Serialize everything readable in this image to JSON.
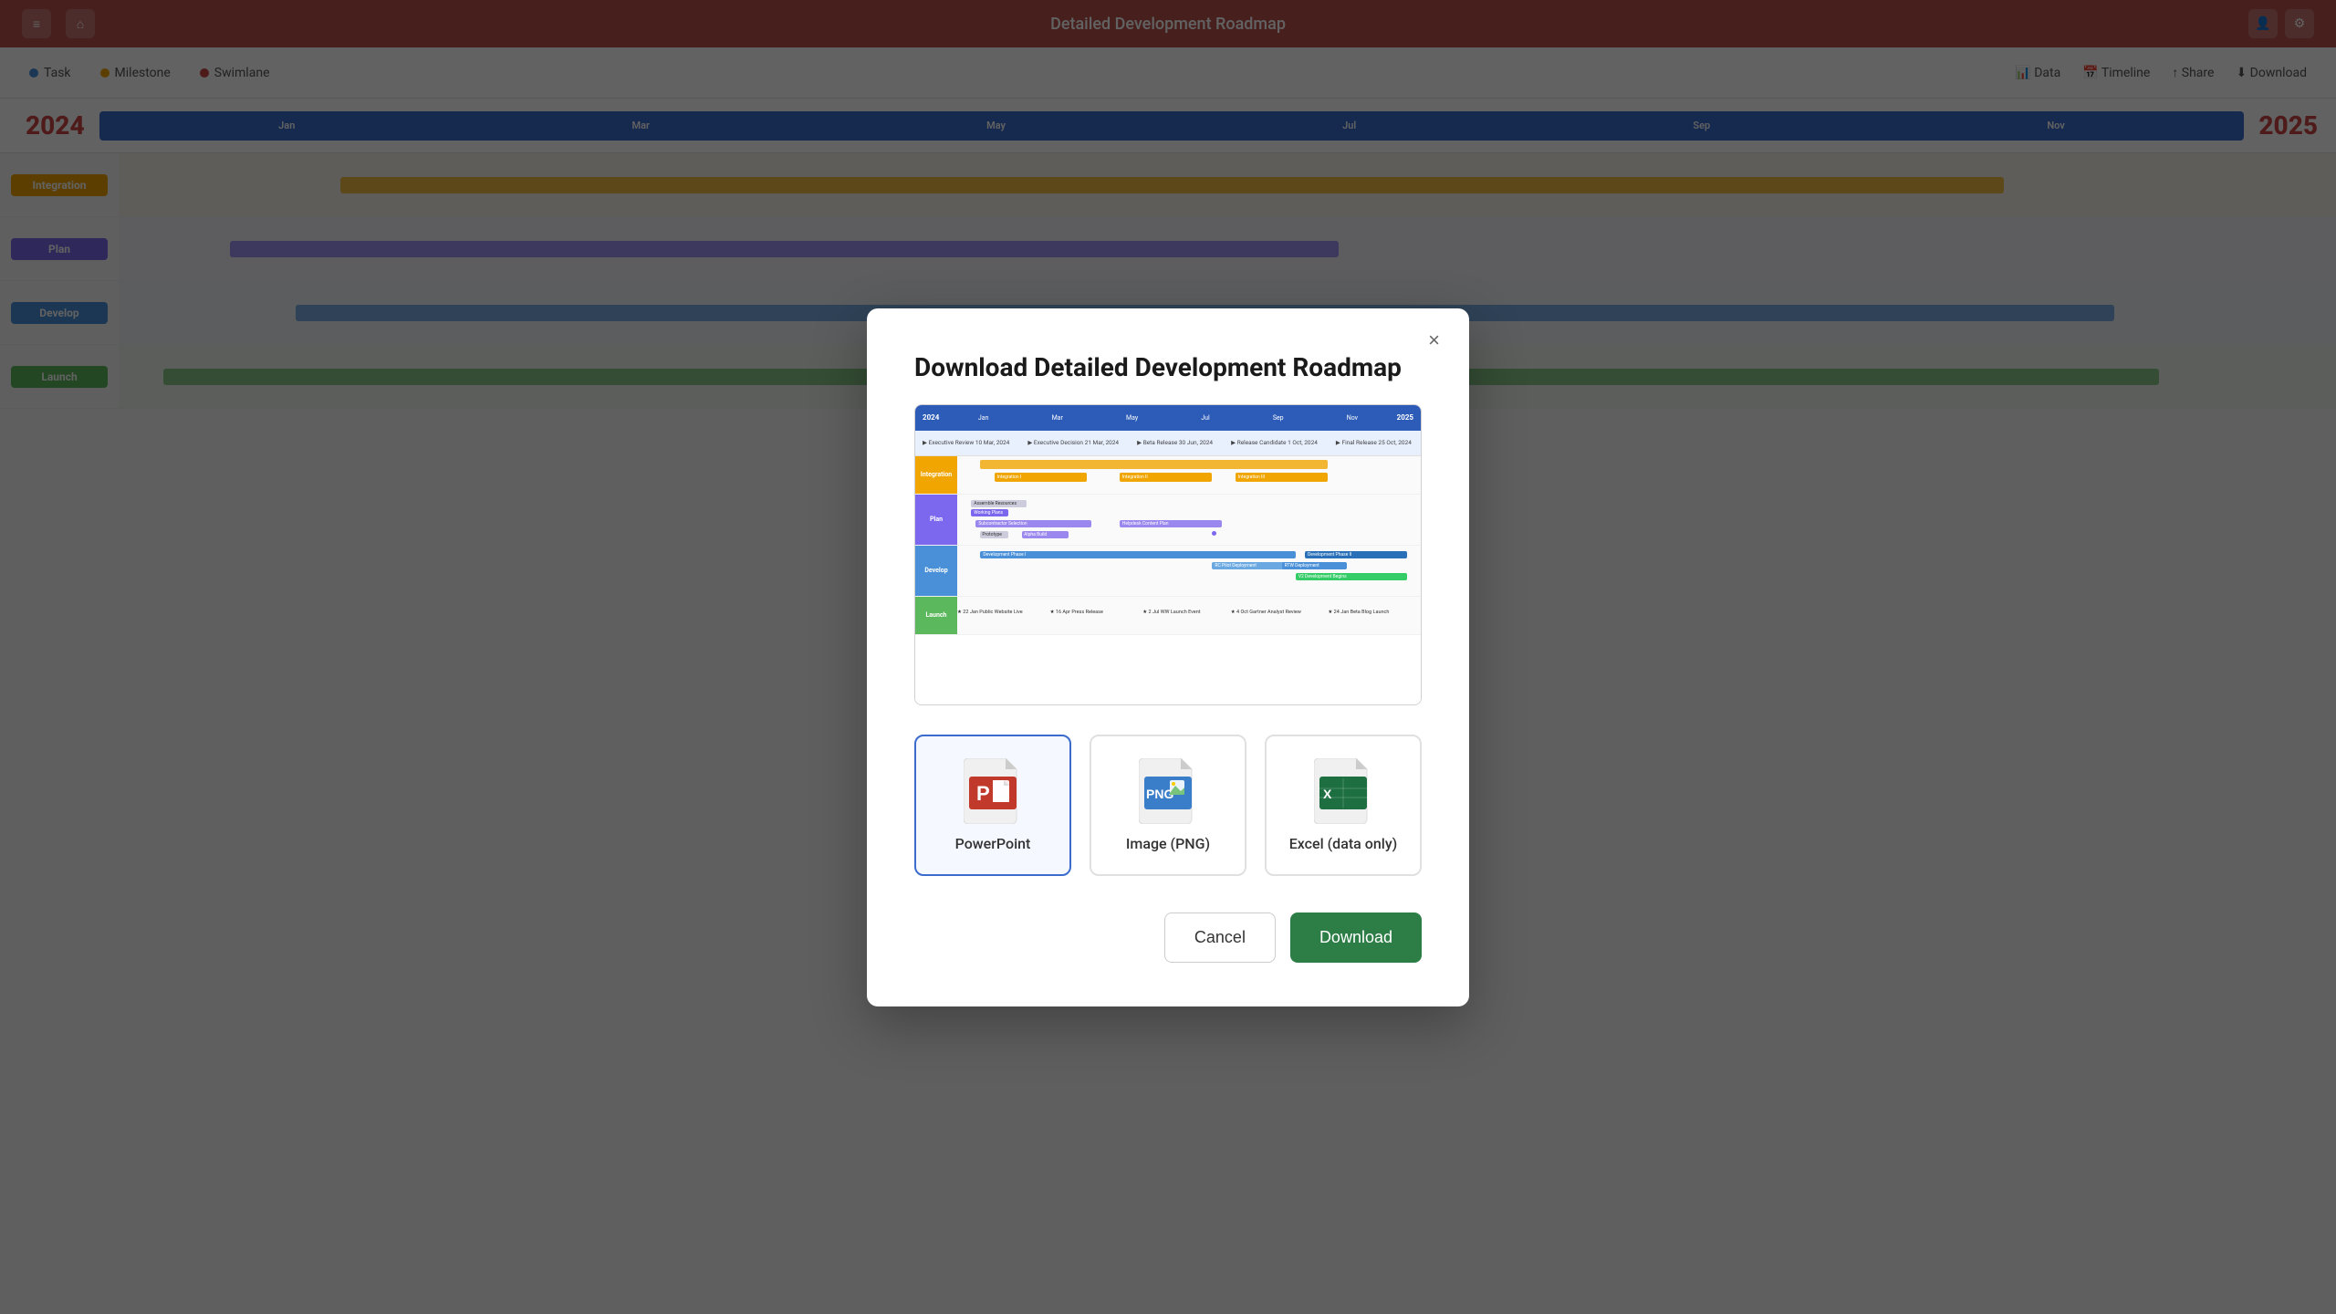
{
  "app": {
    "title": "Detailed Development Roadmap"
  },
  "topbar": {
    "bg_color": "#b85450"
  },
  "toolbar": {
    "items": [
      {
        "label": "Task",
        "dot_color": "#4a90d9"
      },
      {
        "label": "Milestone",
        "dot_color": "#f0a500"
      },
      {
        "label": "Swimlane",
        "dot_color": "#cc4444"
      }
    ],
    "right": [
      {
        "label": "Data"
      },
      {
        "label": "Timeline"
      },
      {
        "label": "Share"
      },
      {
        "label": "Download"
      }
    ]
  },
  "gantt": {
    "year_left": "2024",
    "year_right": "2025",
    "rows": [
      {
        "label": "Integration",
        "color": "#f0a500"
      },
      {
        "label": "Plan",
        "color": "#7b68ee"
      },
      {
        "label": "Develop",
        "color": "#4a90d9"
      },
      {
        "label": "Launch",
        "color": "#5cb85c"
      }
    ]
  },
  "modal": {
    "title": "Download Detailed Development Roadmap",
    "close_label": "×",
    "formats": [
      {
        "id": "powerpoint",
        "label": "PowerPoint",
        "selected": true
      },
      {
        "id": "png",
        "label": "Image (PNG)",
        "selected": false
      },
      {
        "id": "excel",
        "label": "Excel (data only)",
        "selected": false
      }
    ],
    "preview": {
      "months": [
        "Jan",
        "Mar",
        "May",
        "Jul",
        "Sep",
        "Nov"
      ],
      "year_left": "2024",
      "year_right": "2025",
      "rows": [
        {
          "label": "Integration",
          "color": "#f0a500"
        },
        {
          "label": "Plan",
          "color": "#7b68ee"
        },
        {
          "label": "Develop",
          "color": "#4a90d9"
        },
        {
          "label": "Launch",
          "color": "#5cb85c"
        }
      ]
    },
    "cancel_label": "Cancel",
    "download_label": "Download"
  }
}
